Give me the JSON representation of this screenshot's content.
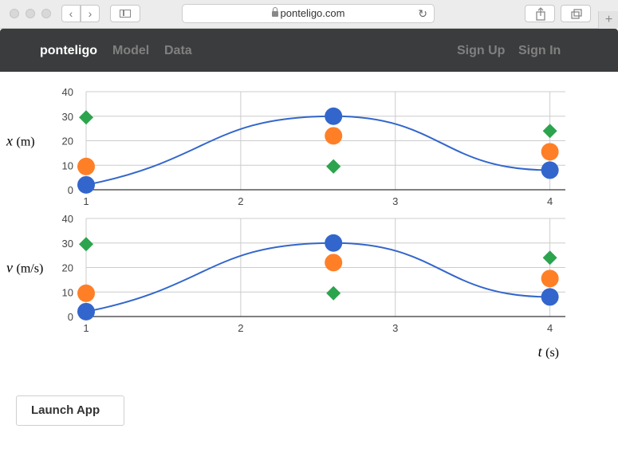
{
  "browser": {
    "url": "ponteligo.com"
  },
  "navbar": {
    "brand": "ponteligo",
    "left_links": [
      "Model",
      "Data"
    ],
    "right_links": [
      "Sign Up",
      "Sign In"
    ]
  },
  "launch_label": "Launch App",
  "chart_data": [
    {
      "type": "scatter",
      "ylabel_var": "x",
      "ylabel_unit": "(m)",
      "ylim": [
        0,
        40
      ],
      "xlim": [
        1,
        4.1
      ],
      "yticks": [
        "0",
        "10",
        "20",
        "30",
        "40"
      ],
      "xticks": [
        "1",
        "2",
        "3",
        "4"
      ],
      "grid": true,
      "series": [
        {
          "marker": "circle",
          "color": "#3366cc",
          "x": [
            1,
            2.6,
            4
          ],
          "y": [
            2,
            30,
            8
          ]
        },
        {
          "marker": "circle",
          "color": "#ff7f27",
          "x": [
            1,
            2.6,
            4
          ],
          "y": [
            9.5,
            22,
            15.5
          ]
        },
        {
          "marker": "diamond",
          "color": "#2ca44e",
          "x": [
            1,
            2.6,
            2.6,
            4
          ],
          "y": [
            29.5,
            9.5,
            9.5,
            24
          ]
        }
      ],
      "curve": {
        "color": "#3366cc",
        "x": [
          1,
          2.6,
          4
        ],
        "y": [
          2,
          30,
          8
        ]
      }
    },
    {
      "type": "scatter",
      "ylabel_var": "v",
      "ylabel_unit": "(m/s)",
      "ylim": [
        0,
        40
      ],
      "xlim": [
        1,
        4.1
      ],
      "yticks": [
        "0",
        "10",
        "20",
        "30",
        "40"
      ],
      "xticks": [
        "1",
        "2",
        "3",
        "4"
      ],
      "grid": true,
      "xlabel_var": "t",
      "xlabel_unit": "(s)",
      "series": [
        {
          "marker": "circle",
          "color": "#3366cc",
          "x": [
            1,
            2.6,
            4
          ],
          "y": [
            2,
            30,
            8
          ]
        },
        {
          "marker": "circle",
          "color": "#ff7f27",
          "x": [
            1,
            2.6,
            4
          ],
          "y": [
            9.5,
            22,
            15.5
          ]
        },
        {
          "marker": "diamond",
          "color": "#2ca44e",
          "x": [
            1,
            2.6,
            4
          ],
          "y": [
            29.5,
            9.5,
            24
          ]
        }
      ],
      "curve": {
        "color": "#3366cc",
        "x": [
          1,
          2.6,
          4
        ],
        "y": [
          2,
          30,
          8
        ]
      }
    }
  ]
}
